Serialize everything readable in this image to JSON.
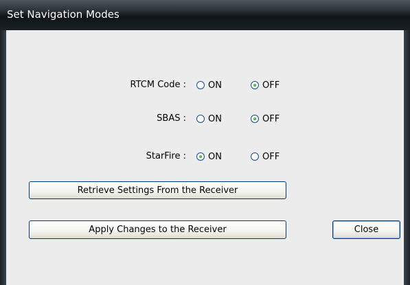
{
  "window": {
    "title": "Set Navigation Modes"
  },
  "modes": [
    {
      "label": "RTCM Code :",
      "on_label": "ON",
      "off_label": "OFF",
      "selected": "OFF"
    },
    {
      "label": "SBAS :",
      "on_label": "ON",
      "off_label": "OFF",
      "selected": "OFF"
    },
    {
      "label": "StarFire :",
      "on_label": "ON",
      "off_label": "OFF",
      "selected": "ON"
    }
  ],
  "buttons": {
    "retrieve": "Retrieve Settings From the Receiver",
    "apply": "Apply Changes to the Receiver",
    "close": "Close"
  }
}
